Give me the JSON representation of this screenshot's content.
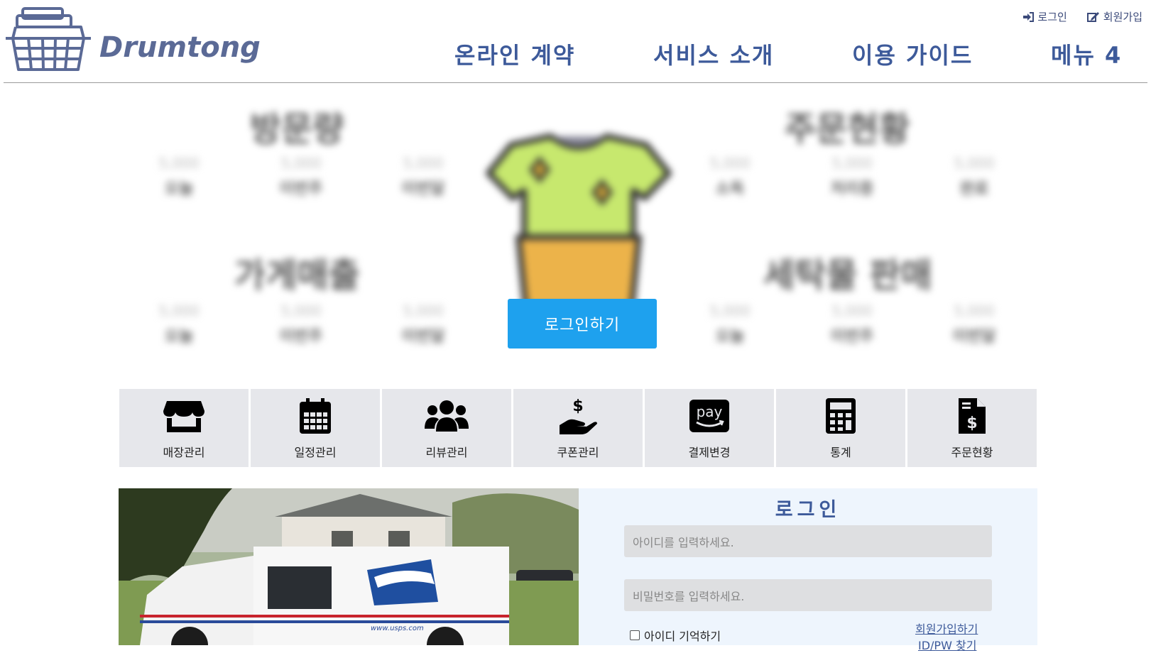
{
  "header": {
    "logo_text": "Drumtong",
    "top_links": {
      "login": "로그인",
      "signup": "회원가입"
    },
    "nav": [
      "온라인 계약",
      "서비스 소개",
      "이용 가이드",
      "메뉴 4"
    ]
  },
  "hero": {
    "stats": {
      "visits": {
        "title": "방문량",
        "items": [
          {
            "num": "5,000",
            "label": "오늘"
          },
          {
            "num": "5,000",
            "label": "이번주"
          },
          {
            "num": "5,000",
            "label": "이번달"
          }
        ]
      },
      "orders": {
        "title": "주문현황",
        "items": [
          {
            "num": "5,000",
            "label": "소독"
          },
          {
            "num": "5,000",
            "label": "처리중"
          },
          {
            "num": "5,000",
            "label": "완료"
          }
        ]
      },
      "sales": {
        "title": "가게매출",
        "items": [
          {
            "num": "5,000",
            "label": "오늘"
          },
          {
            "num": "5,000",
            "label": "이번주"
          },
          {
            "num": "5,000",
            "label": "이번달"
          }
        ]
      },
      "laundry": {
        "title": "세탁물 판매",
        "items": [
          {
            "num": "5,000",
            "label": "오늘"
          },
          {
            "num": "5,000",
            "label": "이번주"
          },
          {
            "num": "5,000",
            "label": "이번달"
          }
        ]
      }
    },
    "login_button": "로그인하기"
  },
  "tiles": [
    {
      "label": "매장관리",
      "icon": "store-icon"
    },
    {
      "label": "일정관리",
      "icon": "calendar-icon"
    },
    {
      "label": "리뷰관리",
      "icon": "users-icon"
    },
    {
      "label": "쿠폰관리",
      "icon": "hand-dollar-icon"
    },
    {
      "label": "결제변경",
      "icon": "amazon-pay-icon"
    },
    {
      "label": "통계",
      "icon": "calculator-icon"
    },
    {
      "label": "주문현황",
      "icon": "invoice-dollar-icon"
    }
  ],
  "login": {
    "title": "로그인",
    "id_placeholder": "아이디를 입력하세요.",
    "pw_placeholder": "비밀번호를 입력하세요.",
    "remember": "아이디 기억하기",
    "signup_link": "회원가입하기",
    "find_link": "ID/PW 찾기"
  },
  "colors": {
    "brand": "#3d5a9a",
    "cta": "#1ea1ee",
    "tile_bg": "#e6e7eb",
    "panel_bg": "#eef5fd"
  }
}
